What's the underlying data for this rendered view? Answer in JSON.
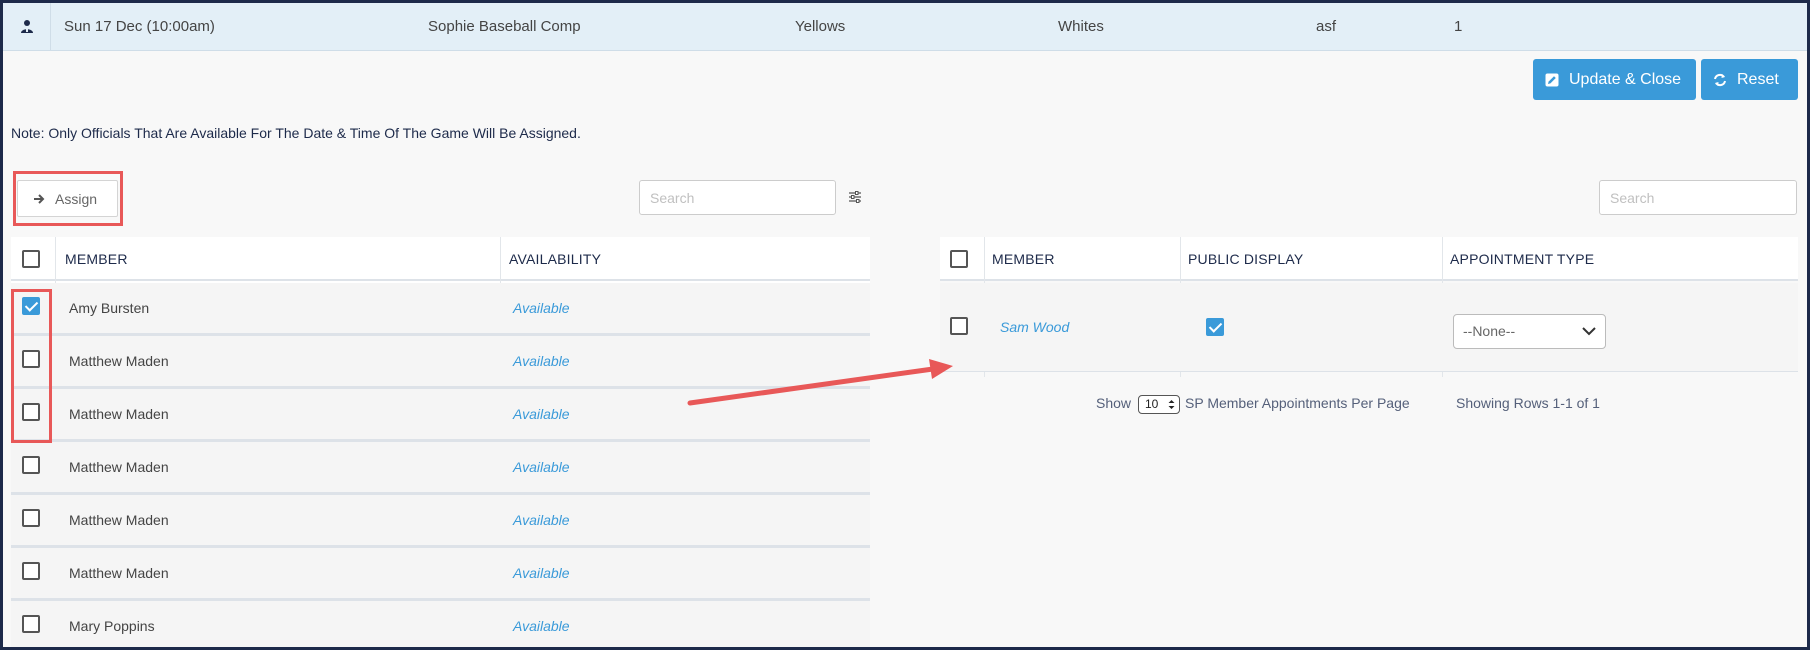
{
  "game": {
    "date": "Sun 17 Dec (10:00am)",
    "competition": "Sophie Baseball Comp",
    "home": "Yellows",
    "away": "Whites",
    "venue": "asf",
    "round": "1"
  },
  "actions": {
    "update_close": "Update & Close",
    "reset": "Reset"
  },
  "note": "Note: Only Officials That Are Available For The Date & Time Of The Game Will Be Assigned.",
  "assign_label": "Assign",
  "left_search": {
    "placeholder": "Search"
  },
  "right_search": {
    "placeholder": "Search"
  },
  "left_table": {
    "headers": {
      "member": "MEMBER",
      "availability": "AVAILABILITY"
    },
    "rows": [
      {
        "name": "Amy Bursten",
        "availability": "Available",
        "checked": true
      },
      {
        "name": "Matthew Maden",
        "availability": "Available",
        "checked": false
      },
      {
        "name": "Matthew Maden",
        "availability": "Available",
        "checked": false
      },
      {
        "name": "Matthew Maden",
        "availability": "Available",
        "checked": false
      },
      {
        "name": "Matthew Maden",
        "availability": "Available",
        "checked": false
      },
      {
        "name": "Matthew Maden",
        "availability": "Available",
        "checked": false
      },
      {
        "name": "Mary Poppins",
        "availability": "Available",
        "checked": false
      }
    ]
  },
  "right_table": {
    "headers": {
      "member": "MEMBER",
      "public_display": "PUBLIC DISPLAY",
      "appointment_type": "APPOINTMENT TYPE"
    },
    "rows": [
      {
        "name": "Sam Wood",
        "public_display": true,
        "appointment_type": "--None--"
      }
    ]
  },
  "pagination": {
    "show_label": "Show",
    "per_page": "10",
    "per_page_label": "SP Member Appointments Per Page",
    "showing": "Showing Rows 1-1 of 1"
  },
  "colors": {
    "accent": "#3a9ad9",
    "annotation": "#e85858",
    "header_row": "#e3eff7"
  }
}
